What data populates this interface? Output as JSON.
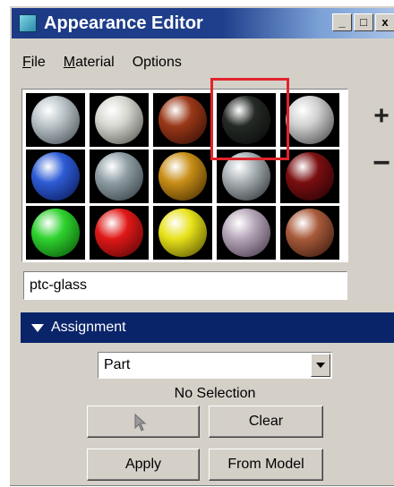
{
  "window": {
    "title": "Appearance Editor",
    "controls": {
      "minimize": "_",
      "maximize": "□",
      "close": "x"
    }
  },
  "menu": {
    "items": [
      {
        "label": "File",
        "mnemonic": "F",
        "rest": "ile"
      },
      {
        "label": "Material",
        "mnemonic": "M",
        "rest": "aterial"
      },
      {
        "label": "Options",
        "mnemonic": "",
        "rest": "Options"
      }
    ]
  },
  "palette": {
    "swatches": [
      {
        "color": "#b9c3c8",
        "shade": "#3b4449",
        "icon": "sphere-swatch"
      },
      {
        "color": "#d6d6d0",
        "shade": "#4a4a44",
        "icon": "sphere-swatch"
      },
      {
        "color": "#9a3818",
        "shade": "#2a0a04",
        "icon": "sphere-swatch"
      },
      {
        "color": "#252a26",
        "shade": "#050605",
        "icon": "sphere-swatch"
      },
      {
        "color": "#cfcfcf",
        "shade": "#3a3a3a",
        "icon": "sphere-swatch"
      },
      {
        "color": "#2e5dd6",
        "shade": "#06124a",
        "icon": "sphere-swatch"
      },
      {
        "color": "#8f9ea4",
        "shade": "#283236",
        "icon": "sphere-swatch"
      },
      {
        "color": "#c88e16",
        "shade": "#3a2402",
        "icon": "sphere-swatch"
      },
      {
        "color": "#a8b0b4",
        "shade": "#202426",
        "icon": "sphere-swatch"
      },
      {
        "color": "#7a0e10",
        "shade": "#1e0203",
        "icon": "sphere-swatch"
      },
      {
        "color": "#2fd22f",
        "shade": "#064a06",
        "icon": "sphere-swatch"
      },
      {
        "color": "#e01818",
        "shade": "#4a0404",
        "icon": "sphere-swatch"
      },
      {
        "color": "#e8e21a",
        "shade": "#4a4402",
        "icon": "sphere-swatch"
      },
      {
        "color": "#b5a5b8",
        "shade": "#3a2e3e",
        "icon": "sphere-swatch"
      },
      {
        "color": "#a85a3a",
        "shade": "#2e140a",
        "icon": "sphere-swatch"
      }
    ],
    "selected_index": 3,
    "selection_color": "#e0242b",
    "add_label": "+",
    "remove_label": "−"
  },
  "material_name": {
    "value": "ptc-glass"
  },
  "assignment": {
    "header": "Assignment",
    "header_color": "#0a246a",
    "target_select": {
      "value": "Part"
    },
    "status": "No Selection",
    "buttons": {
      "pick_icon": "pointer-icon",
      "clear": "Clear",
      "apply": "Apply",
      "from_model": "From Model"
    }
  }
}
